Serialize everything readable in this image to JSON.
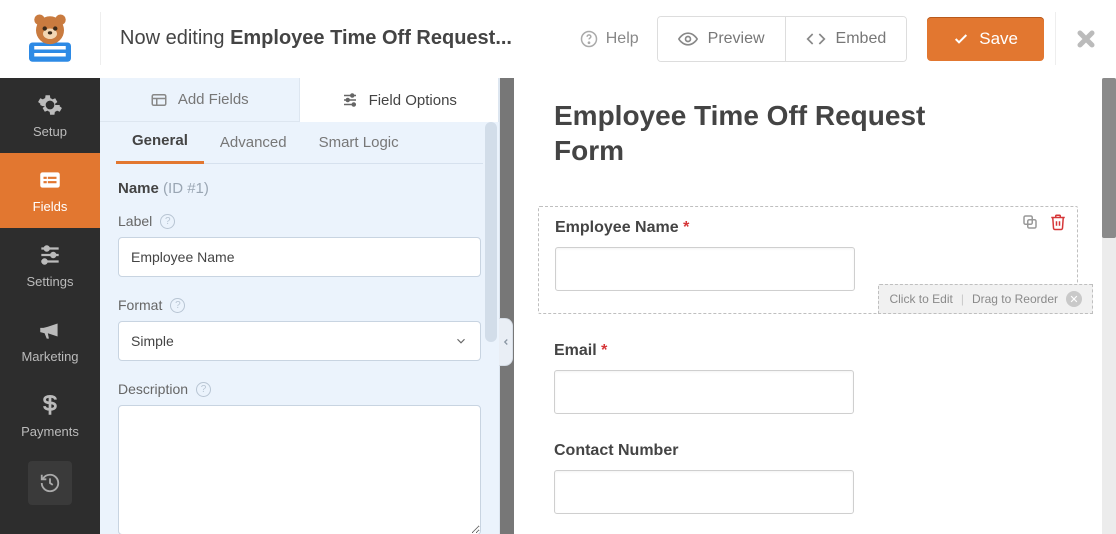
{
  "header": {
    "editing_prefix": "Now editing ",
    "editing_title": "Employee Time Off Request...",
    "help": "Help",
    "preview": "Preview",
    "embed": "Embed",
    "save": "Save"
  },
  "sidebar": {
    "items": [
      "Setup",
      "Fields",
      "Settings",
      "Marketing",
      "Payments"
    ]
  },
  "panel": {
    "tabs": {
      "add": "Add Fields",
      "options": "Field Options"
    },
    "sub_tabs": {
      "general": "General",
      "advanced": "Advanced",
      "smart": "Smart Logic"
    },
    "section": {
      "name": "Name",
      "id_note": "(ID #1)"
    },
    "label": {
      "title": "Label",
      "value": "Employee Name"
    },
    "format": {
      "title": "Format",
      "selected": "Simple"
    },
    "description": {
      "title": "Description",
      "value": ""
    }
  },
  "preview": {
    "form_title": "Employee Time Off Request Form",
    "fields": {
      "employee_name": {
        "label": "Employee Name",
        "required": true
      },
      "email": {
        "label": "Email",
        "required": true
      },
      "contact": {
        "label": "Contact Number",
        "required": false
      }
    },
    "hint": {
      "edit": "Click to Edit",
      "drag": "Drag to Reorder"
    }
  }
}
